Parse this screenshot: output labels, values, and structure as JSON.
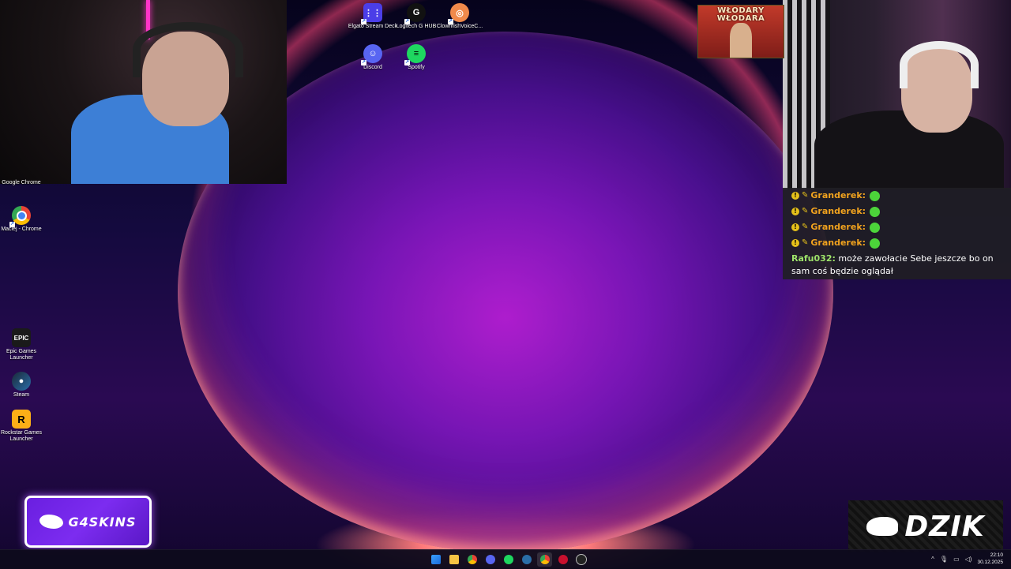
{
  "desktop": {
    "icons_top": [
      {
        "label": "Elgato Stream Deck",
        "color": "#4b3ee8"
      },
      {
        "label": "Logitech G HUB",
        "color": "#111111"
      },
      {
        "label": "ClownfishVoiceC...",
        "color": "#f08a4b"
      },
      {
        "label": "Discord",
        "color": "#5865f2"
      },
      {
        "label": "Spotify",
        "color": "#1ed760"
      }
    ],
    "icons_left": [
      {
        "label": "Google Chrome"
      },
      {
        "label": "Maciej - Chrome"
      },
      {
        "label": "Epic Games Launcher",
        "glyph": "EPIC"
      },
      {
        "label": "Steam"
      },
      {
        "label": "Rockstar Games Launcher",
        "glyph": "R"
      }
    ]
  },
  "poster": {
    "title": "WŁODARY WŁODARA"
  },
  "chat": {
    "messages": [
      {
        "user": "Granderek:"
      },
      {
        "user": "Granderek:"
      },
      {
        "user": "Granderek:"
      },
      {
        "user": "Granderek:"
      },
      {
        "user": "Rafu032:",
        "text": " może zawołacie Sebe jeszcze bo on sam coś będzie oglądał"
      }
    ]
  },
  "sponsors": {
    "left": "G4SKINS",
    "right": "DZIK"
  },
  "taskbar": {
    "time": "22:10",
    "date": "30.12.2025",
    "tray_chevron": "^"
  }
}
